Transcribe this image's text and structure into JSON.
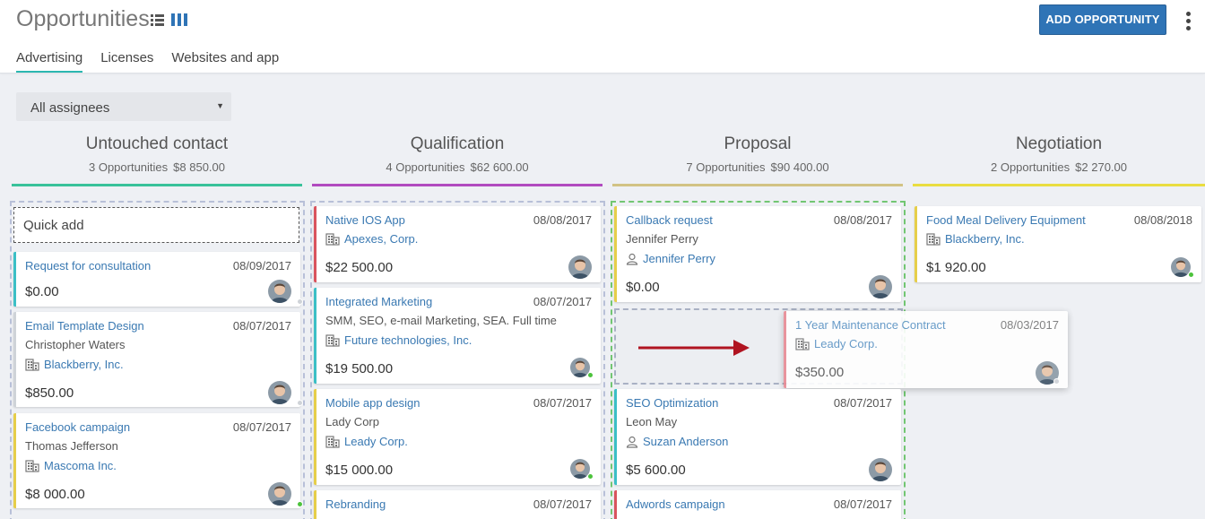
{
  "header": {
    "title": "Opportunities",
    "view_icons": [
      "list-view-icon",
      "board-view-icon"
    ],
    "add_button": "ADD OPPORTUNITY",
    "tabs": [
      "Advertising",
      "Licenses",
      "Websites and app"
    ],
    "active_tab": "Advertising"
  },
  "filter": {
    "assignee": "All assignees"
  },
  "columns": [
    {
      "title": "Untouched contact",
      "count": "3 Opportunities",
      "total": "$8 850.00",
      "color": "#39c29a"
    },
    {
      "title": "Qualification",
      "count": "4 Opportunities",
      "total": "$62 600.00",
      "color": "#b14bbf"
    },
    {
      "title": "Proposal",
      "count": "7 Opportunities",
      "total": "$90 400.00",
      "color": "#d2c384"
    },
    {
      "title": "Negotiation",
      "count": "2 Opportunities",
      "total": "$2 270.00",
      "color": "#e9dd41"
    }
  ],
  "quick_add": "Quick add",
  "cards": {
    "c1": {
      "title": "Request for consultation",
      "date": "08/09/2017",
      "amount": "$0.00"
    },
    "c2": {
      "title": "Email Template Design",
      "date": "08/07/2017",
      "person": "Christopher Waters",
      "org": "Blackberry, Inc.",
      "amount": "$850.00"
    },
    "c3": {
      "title": "Facebook campaign",
      "date": "08/07/2017",
      "person": "Thomas Jefferson",
      "org": "Mascoma Inc.",
      "amount": "$8 000.00"
    },
    "q1": {
      "title": "Native IOS App",
      "date": "08/08/2017",
      "org": "Apexes, Corp.",
      "amount": "$22 500.00"
    },
    "q2": {
      "title": "Integrated Marketing",
      "date": "08/07/2017",
      "desc": "SMM, SEO, e-mail Marketing, SEA.  Full time",
      "org": "Future technologies, Inc.",
      "amount": "$19 500.00"
    },
    "q3": {
      "title": "Mobile app design",
      "date": "08/07/2017",
      "person": "Lady Corp",
      "org": "Leady Corp.",
      "amount": "$15 000.00"
    },
    "q4": {
      "title": "Rebranding",
      "date": "08/07/2017"
    },
    "p1": {
      "title": "Callback request",
      "date": "08/08/2017",
      "person": "Jennifer Perry",
      "contact": "Jennifer Perry",
      "amount": "$0.00"
    },
    "p2": {
      "title": "1 Year Maintenance Contract",
      "date": "08/03/2017",
      "org": "Leady Corp.",
      "amount": "$350.00"
    },
    "p3": {
      "title": "SEO Optimization",
      "date": "08/07/2017",
      "person": "Leon May",
      "contact": "Suzan Anderson",
      "amount": "$5 600.00"
    },
    "p4": {
      "title": "Adwords campaign",
      "date": "08/07/2017"
    },
    "n1": {
      "title": "Food Meal Delivery Equipment",
      "date": "08/08/2018",
      "org": "Blackberry, Inc.",
      "amount": "$1 920.00"
    }
  },
  "colors": {
    "accent": "#2f74b6",
    "tab_underline": "#2bb7b0",
    "link": "#3a79b2",
    "card_teal": "#3bbfc6",
    "card_yellow": "#e6ce4a",
    "card_red": "#d9545e",
    "drag_arrow": "#b01421",
    "online": "#4cc33c"
  }
}
